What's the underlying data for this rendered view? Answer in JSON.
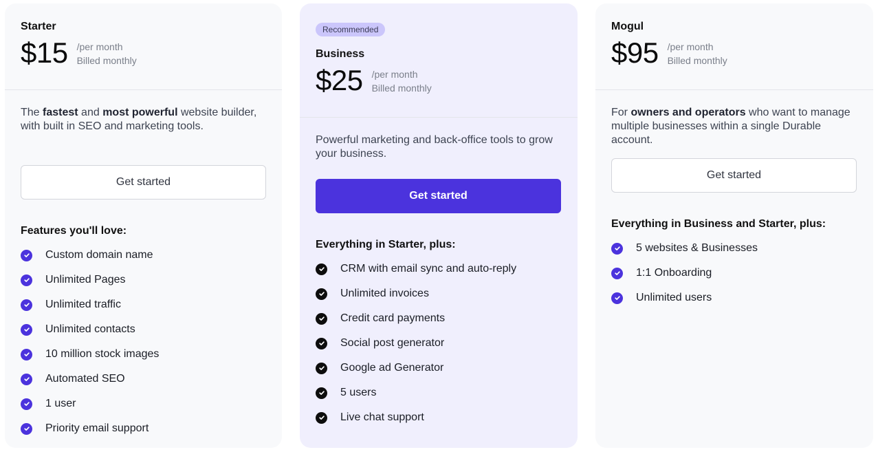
{
  "colors": {
    "accent": "#4b33dd",
    "badge_bg": "#cbc6fb",
    "card_bg": "#f8f9fb",
    "highlight_card_bg": "#f0effd"
  },
  "plans": [
    {
      "name": "Starter",
      "price": "$15",
      "period": "/per month",
      "billing": "Billed monthly",
      "description_parts": [
        "The ",
        "fastest",
        " and ",
        "most powerful",
        " website builder, with built in SEO and marketing tools."
      ],
      "cta_label": "Get started",
      "features_title": "Features you'll love:",
      "check_icon": "check-circle-icon",
      "features": [
        "Custom domain name",
        "Unlimited Pages",
        "Unlimited traffic",
        "Unlimited contacts",
        "10 million stock images",
        "Automated SEO",
        "1 user",
        "Priority email support"
      ]
    },
    {
      "badge": "Recommended",
      "name": "Business",
      "price": "$25",
      "period": "/per month",
      "billing": "Billed monthly",
      "description": "Powerful marketing and back-office tools to grow your business.",
      "cta_label": "Get started",
      "features_title": "Everything in Starter, plus:",
      "check_icon": "check-circle-icon",
      "features": [
        "CRM with email sync and auto-reply",
        "Unlimited invoices",
        "Credit card payments",
        "Social post generator",
        "Google ad Generator",
        "5 users",
        "Live chat support"
      ]
    },
    {
      "name": "Mogul",
      "price": "$95",
      "period": "/per month",
      "billing": "Billed monthly",
      "description_parts": [
        "For ",
        "owners and operators",
        " who want to manage multiple businesses within a single Durable account."
      ],
      "cta_label": "Get started",
      "features_title": "Everything in Business and Starter, plus:",
      "check_icon": "check-circle-icon",
      "features": [
        "5 websites & Businesses",
        "1:1 Onboarding",
        "Unlimited users"
      ]
    }
  ]
}
